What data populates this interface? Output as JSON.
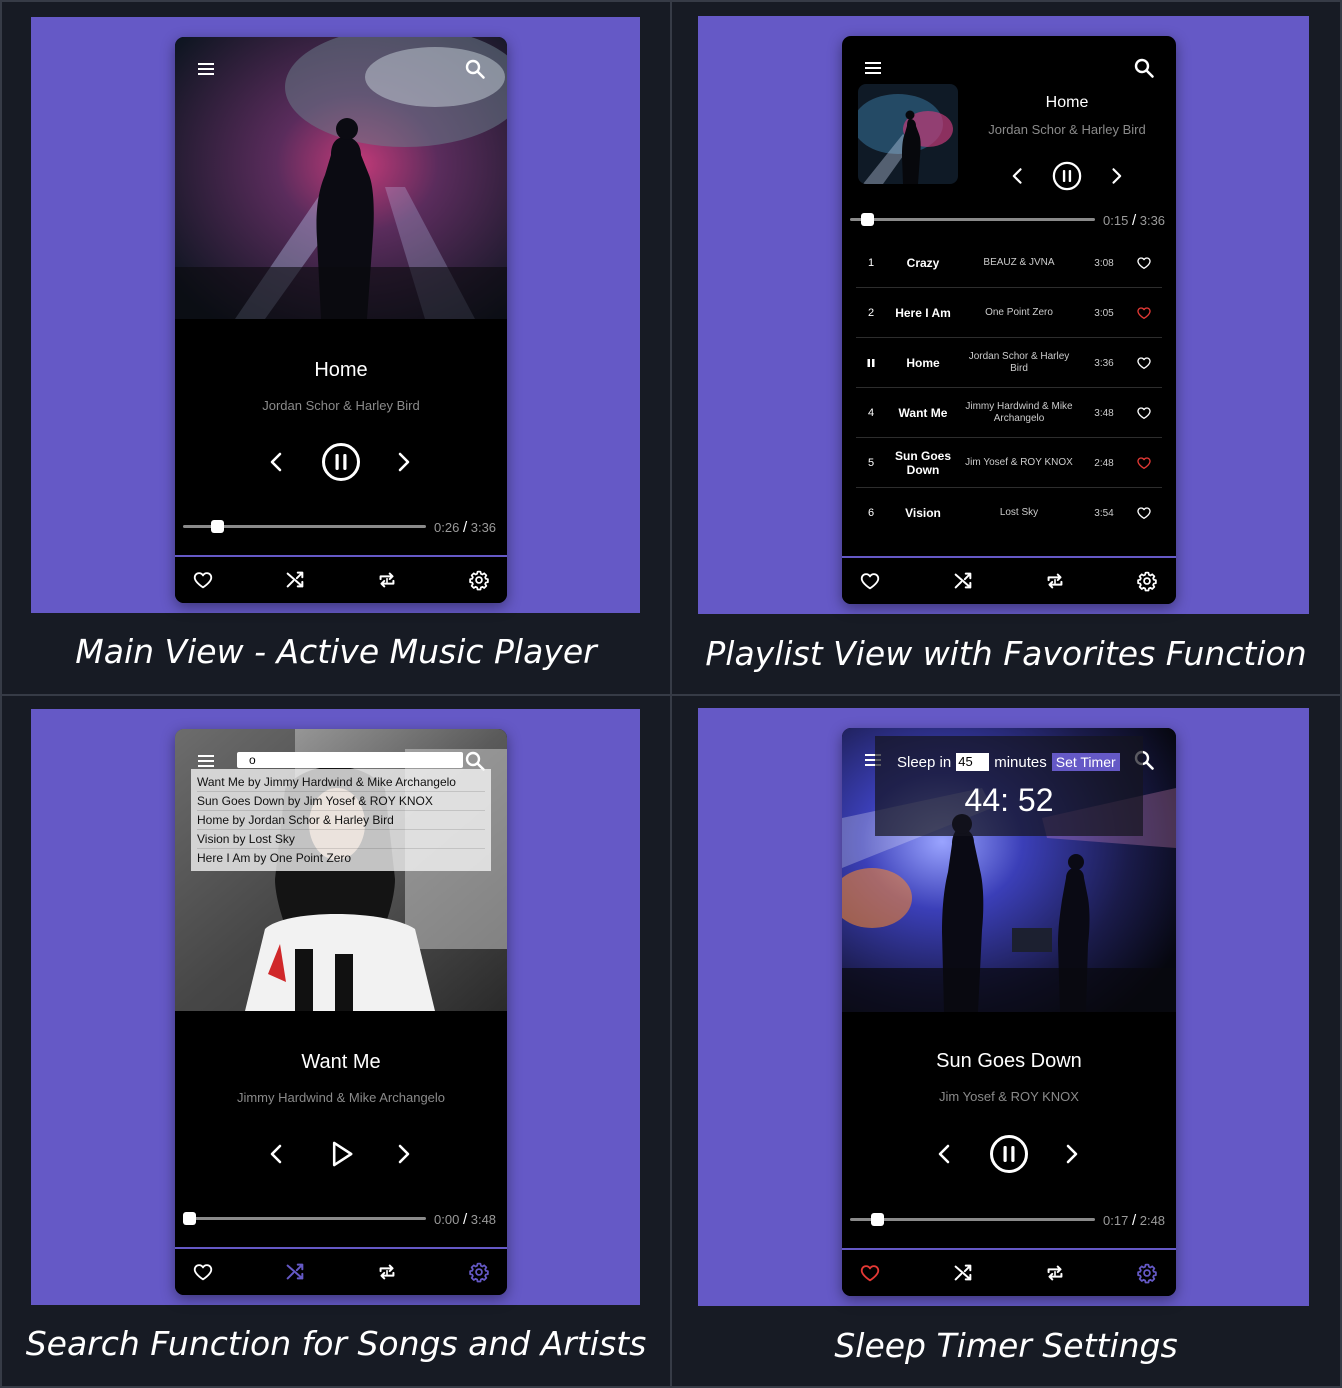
{
  "captions": [
    "Main View - Active Music Player",
    "Playlist View with Favorites Function",
    "Search Function for Songs and Artists",
    "Sleep Timer Settings"
  ],
  "accent_color": "#6559c6",
  "favorite_color": "#e53935",
  "icons": {
    "menu": "menu-icon",
    "search": "search-icon",
    "prev": "chevron-left-icon",
    "next": "chevron-right-icon",
    "pause": "pause-circle-icon",
    "play": "play-icon",
    "heart": "heart-icon",
    "shuffle": "shuffle-icon",
    "repeat": "repeat-icon",
    "settings": "gear-icon"
  },
  "main_view": {
    "song_title": "Home",
    "artist": "Jordan Schor & Harley Bird",
    "current_time": "0:26",
    "separator": "/",
    "duration": "3:36",
    "progress": 0.14,
    "state": "playing"
  },
  "playlist_view": {
    "song_title": "Home",
    "artist": "Jordan Schor & Harley Bird",
    "current_time": "0:15",
    "separator": "/",
    "duration": "3:36",
    "progress": 0.07,
    "tracks": [
      {
        "num": "1",
        "title": "Crazy",
        "artist": "BEAUZ & JVNA",
        "duration": "3:08",
        "favorite": false
      },
      {
        "num": "2",
        "title": "Here I Am",
        "artist": "One Point Zero",
        "duration": "3:05",
        "favorite": true
      },
      {
        "num": "",
        "title": "Home",
        "artist": "Jordan Schor & Harley Bird",
        "duration": "3:36",
        "favorite": false,
        "playing": true
      },
      {
        "num": "4",
        "title": "Want Me",
        "artist": "Jimmy Hardwind & Mike Archangelo",
        "duration": "3:48",
        "favorite": false
      },
      {
        "num": "5",
        "title": "Sun Goes Down",
        "artist": "Jim Yosef & ROY KNOX",
        "duration": "2:48",
        "favorite": true
      },
      {
        "num": "6",
        "title": "Vision",
        "artist": "Lost Sky",
        "duration": "3:54",
        "favorite": false
      }
    ]
  },
  "search_view": {
    "query": "o",
    "results": [
      "Want Me by Jimmy Hardwind & Mike Archangelo",
      "Sun Goes Down by Jim Yosef & ROY KNOX",
      "Home by Jordan Schor & Harley Bird",
      "Vision by Lost Sky",
      "Here I Am by One Point Zero"
    ],
    "song_title": "Want Me",
    "artist": "Jimmy Hardwind & Mike Archangelo",
    "current_time": "0:00",
    "separator": "/",
    "duration": "3:48",
    "progress": 0.0,
    "state": "paused"
  },
  "sleep_view": {
    "sleep_label": "Sleep in",
    "minutes_value": "45",
    "minutes_label": "minutes",
    "set_button": "Set Timer",
    "countdown": "44: 52",
    "song_title": "Sun Goes Down",
    "artist": "Jim Yosef & ROY KNOX",
    "current_time": "0:17",
    "separator": "/",
    "duration": "2:48",
    "progress": 0.11,
    "state": "playing"
  }
}
